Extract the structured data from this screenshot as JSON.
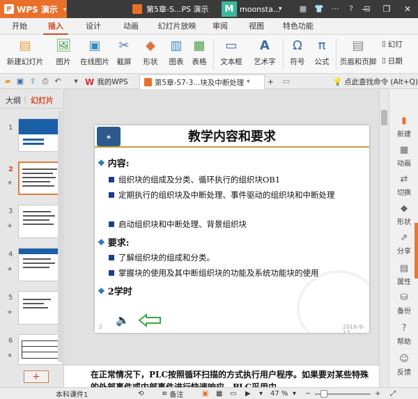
{
  "app": {
    "brand": "WPS 演示",
    "doc_title": "第5章-S...PS 演示",
    "account_initial": "M",
    "account_name": "moonsta..."
  },
  "menu_tabs": [
    "开始",
    "插入",
    "设计",
    "动画",
    "幻灯片放映",
    "审阅",
    "视图",
    "特色功能"
  ],
  "active_menu": "插入",
  "ribbon": {
    "new_slide": "新建幻灯片",
    "picture": "图片",
    "online_picture": "在线图片",
    "screenshot": "截屏",
    "shape": "形状",
    "chart": "图表",
    "table": "表格",
    "textbox": "文本框",
    "wordart": "艺术字",
    "symbol": "符号",
    "formula": "公式",
    "header_footer": "页眉和页脚",
    "slide_num": "幻灯",
    "date": "日期"
  },
  "tabs": {
    "my_wps": "我的WPS",
    "active_doc": "第5章-S7-3...块及中断处理 *",
    "add": "+",
    "help_search": "点此查找命令 (Alt+Q)"
  },
  "left_panel": {
    "tab_outline": "大纲",
    "tab_slides": "幻灯片",
    "slide_numbers": [
      "1",
      "2",
      "3",
      "4",
      "5",
      "6"
    ],
    "add_button": "+"
  },
  "slide": {
    "title": "教学内容和要求",
    "sections": [
      {
        "heading": "内容:",
        "bullets": [
          "组织块的组成及分类、循环执行的组织块OB1",
          "定期执行的组织块及中断处理、事件驱动的组织块和中断处理",
          "启动组织块和中断处理、背景组织块"
        ]
      },
      {
        "heading": "要求:",
        "bullets": [
          "了解组织块的组成和分类。",
          "掌握块的使用及其中断组织块的功能及系统功能块的使用"
        ]
      },
      {
        "heading": "2学时",
        "bullets": []
      }
    ],
    "footer_num": "2",
    "footer_date": "2016-9-17"
  },
  "notes": {
    "text": "在正常情况下，PLC按照循环扫描的方式执行用户程序。如果要对某些特殊的外部事件或内部事件进行快速响应，PLC采用中"
  },
  "right_panel": {
    "items": [
      "新建",
      "动画",
      "切换",
      "形状",
      "分享",
      "属性",
      "备份",
      "帮助",
      "反馈"
    ]
  },
  "status": {
    "template": "本科课件1",
    "notes_label": "备注",
    "zoom": "47 %"
  },
  "colors": {
    "accent": "#e8702a",
    "active_tab": "#d24726",
    "title_bar": "#3a3a3a",
    "bullet_square": "#1e3d8a",
    "heading_diamond": "#2a7db5"
  }
}
